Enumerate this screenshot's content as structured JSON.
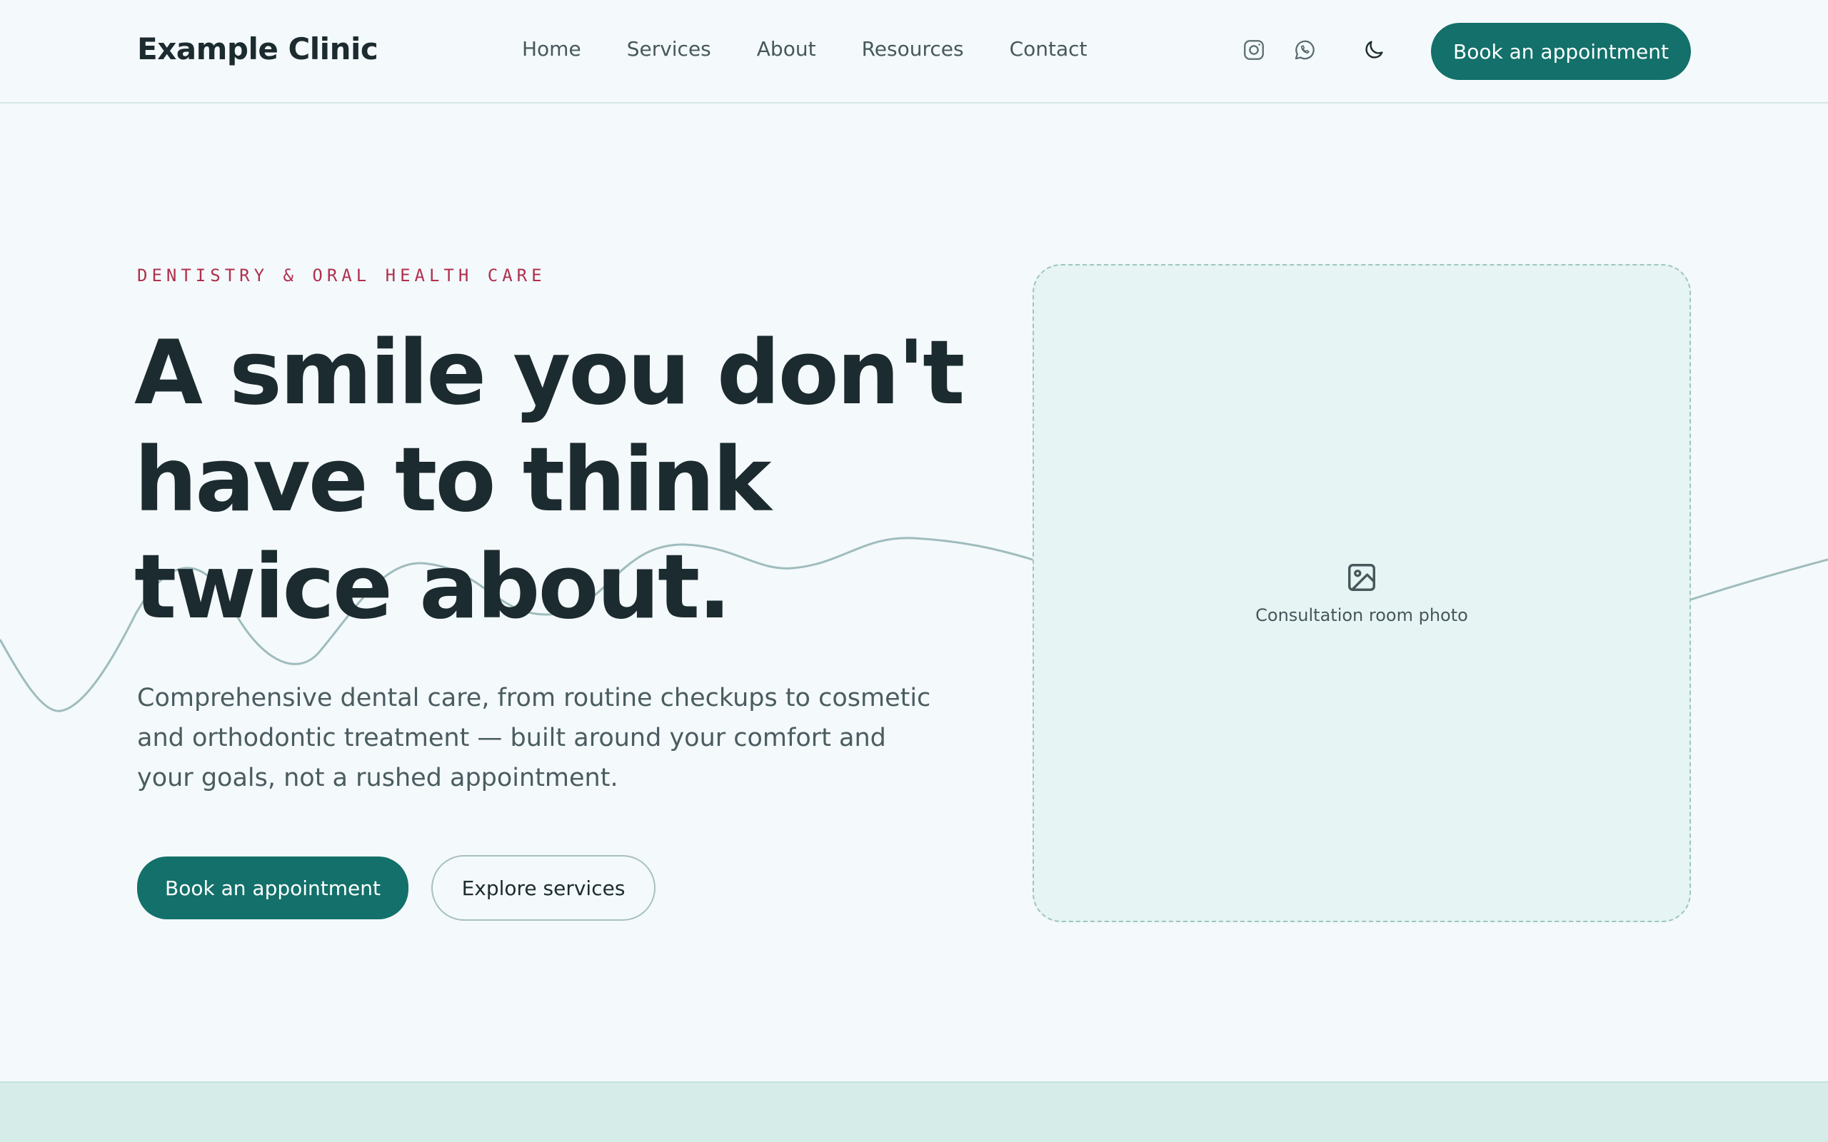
{
  "header": {
    "brand": "Example Clinic",
    "nav": [
      "Home",
      "Services",
      "About",
      "Resources",
      "Contact"
    ],
    "icons": [
      "instagram-icon",
      "whatsapp-icon",
      "moon-icon"
    ],
    "cta": "Book an appointment"
  },
  "hero": {
    "eyebrow": "DENTISTRY & ORAL HEALTH CARE",
    "headline": [
      "A smile you don't",
      "have to think",
      "twice about."
    ],
    "lede": "Comprehensive dental care, from routine checkups to cosmetic and orthodontic treatment — built around your comfort and your goals, not a rushed appointment.",
    "primary_button": "Book an appointment",
    "secondary_button": "Explore services",
    "photo_label": "Consultation room photo"
  },
  "colors": {
    "accent": "#13706a",
    "eyebrow": "#b0304e",
    "background": "#f4f9fb",
    "text": "#1c2b2f",
    "placeholder": "#e6f4f3"
  }
}
